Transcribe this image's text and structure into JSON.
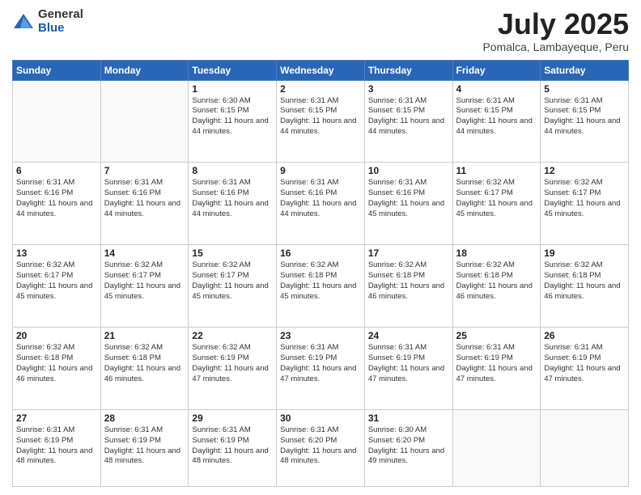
{
  "header": {
    "logo_general": "General",
    "logo_blue": "Blue",
    "month_title": "July 2025",
    "subtitle": "Pomalca, Lambayeque, Peru"
  },
  "days_of_week": [
    "Sunday",
    "Monday",
    "Tuesday",
    "Wednesday",
    "Thursday",
    "Friday",
    "Saturday"
  ],
  "weeks": [
    [
      {
        "day": "",
        "info": ""
      },
      {
        "day": "",
        "info": ""
      },
      {
        "day": "1",
        "info": "Sunrise: 6:30 AM\nSunset: 6:15 PM\nDaylight: 11 hours and 44 minutes."
      },
      {
        "day": "2",
        "info": "Sunrise: 6:31 AM\nSunset: 6:15 PM\nDaylight: 11 hours and 44 minutes."
      },
      {
        "day": "3",
        "info": "Sunrise: 6:31 AM\nSunset: 6:15 PM\nDaylight: 11 hours and 44 minutes."
      },
      {
        "day": "4",
        "info": "Sunrise: 6:31 AM\nSunset: 6:15 PM\nDaylight: 11 hours and 44 minutes."
      },
      {
        "day": "5",
        "info": "Sunrise: 6:31 AM\nSunset: 6:15 PM\nDaylight: 11 hours and 44 minutes."
      }
    ],
    [
      {
        "day": "6",
        "info": "Sunrise: 6:31 AM\nSunset: 6:16 PM\nDaylight: 11 hours and 44 minutes."
      },
      {
        "day": "7",
        "info": "Sunrise: 6:31 AM\nSunset: 6:16 PM\nDaylight: 11 hours and 44 minutes."
      },
      {
        "day": "8",
        "info": "Sunrise: 6:31 AM\nSunset: 6:16 PM\nDaylight: 11 hours and 44 minutes."
      },
      {
        "day": "9",
        "info": "Sunrise: 6:31 AM\nSunset: 6:16 PM\nDaylight: 11 hours and 44 minutes."
      },
      {
        "day": "10",
        "info": "Sunrise: 6:31 AM\nSunset: 6:16 PM\nDaylight: 11 hours and 45 minutes."
      },
      {
        "day": "11",
        "info": "Sunrise: 6:32 AM\nSunset: 6:17 PM\nDaylight: 11 hours and 45 minutes."
      },
      {
        "day": "12",
        "info": "Sunrise: 6:32 AM\nSunset: 6:17 PM\nDaylight: 11 hours and 45 minutes."
      }
    ],
    [
      {
        "day": "13",
        "info": "Sunrise: 6:32 AM\nSunset: 6:17 PM\nDaylight: 11 hours and 45 minutes."
      },
      {
        "day": "14",
        "info": "Sunrise: 6:32 AM\nSunset: 6:17 PM\nDaylight: 11 hours and 45 minutes."
      },
      {
        "day": "15",
        "info": "Sunrise: 6:32 AM\nSunset: 6:17 PM\nDaylight: 11 hours and 45 minutes."
      },
      {
        "day": "16",
        "info": "Sunrise: 6:32 AM\nSunset: 6:18 PM\nDaylight: 11 hours and 45 minutes."
      },
      {
        "day": "17",
        "info": "Sunrise: 6:32 AM\nSunset: 6:18 PM\nDaylight: 11 hours and 46 minutes."
      },
      {
        "day": "18",
        "info": "Sunrise: 6:32 AM\nSunset: 6:18 PM\nDaylight: 11 hours and 46 minutes."
      },
      {
        "day": "19",
        "info": "Sunrise: 6:32 AM\nSunset: 6:18 PM\nDaylight: 11 hours and 46 minutes."
      }
    ],
    [
      {
        "day": "20",
        "info": "Sunrise: 6:32 AM\nSunset: 6:18 PM\nDaylight: 11 hours and 46 minutes."
      },
      {
        "day": "21",
        "info": "Sunrise: 6:32 AM\nSunset: 6:18 PM\nDaylight: 11 hours and 46 minutes."
      },
      {
        "day": "22",
        "info": "Sunrise: 6:32 AM\nSunset: 6:19 PM\nDaylight: 11 hours and 47 minutes."
      },
      {
        "day": "23",
        "info": "Sunrise: 6:31 AM\nSunset: 6:19 PM\nDaylight: 11 hours and 47 minutes."
      },
      {
        "day": "24",
        "info": "Sunrise: 6:31 AM\nSunset: 6:19 PM\nDaylight: 11 hours and 47 minutes."
      },
      {
        "day": "25",
        "info": "Sunrise: 6:31 AM\nSunset: 6:19 PM\nDaylight: 11 hours and 47 minutes."
      },
      {
        "day": "26",
        "info": "Sunrise: 6:31 AM\nSunset: 6:19 PM\nDaylight: 11 hours and 47 minutes."
      }
    ],
    [
      {
        "day": "27",
        "info": "Sunrise: 6:31 AM\nSunset: 6:19 PM\nDaylight: 11 hours and 48 minutes."
      },
      {
        "day": "28",
        "info": "Sunrise: 6:31 AM\nSunset: 6:19 PM\nDaylight: 11 hours and 48 minutes."
      },
      {
        "day": "29",
        "info": "Sunrise: 6:31 AM\nSunset: 6:19 PM\nDaylight: 11 hours and 48 minutes."
      },
      {
        "day": "30",
        "info": "Sunrise: 6:31 AM\nSunset: 6:20 PM\nDaylight: 11 hours and 48 minutes."
      },
      {
        "day": "31",
        "info": "Sunrise: 6:30 AM\nSunset: 6:20 PM\nDaylight: 11 hours and 49 minutes."
      },
      {
        "day": "",
        "info": ""
      },
      {
        "day": "",
        "info": ""
      }
    ]
  ]
}
